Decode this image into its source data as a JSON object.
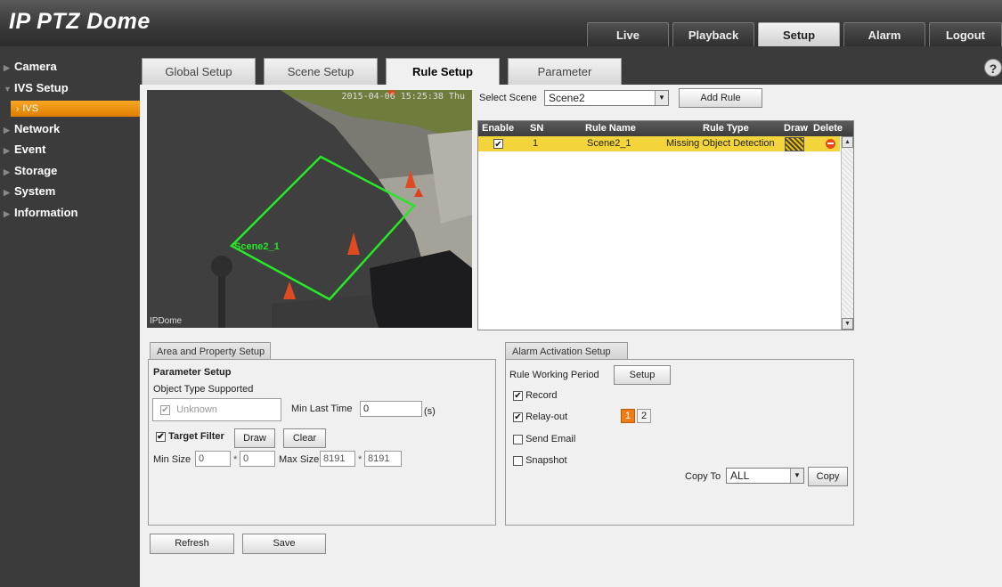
{
  "app": {
    "title": "IP PTZ Dome"
  },
  "topnav": [
    "Live",
    "Playback",
    "Setup",
    "Alarm",
    "Logout"
  ],
  "sidebar": {
    "items": [
      "Camera",
      "IVS Setup",
      "Network",
      "Event",
      "Storage",
      "System",
      "Information"
    ],
    "sub_item": "IVS"
  },
  "tabs": [
    "Global Setup",
    "Scene Setup",
    "Rule Setup",
    "Parameter"
  ],
  "help_icon": "?",
  "video": {
    "timestamp": "2015-04-06 15:25:38 Thu",
    "osd_label": "IPDome",
    "rule_label": "Scene2_1",
    "rule_color": "#27e827"
  },
  "select_scene": {
    "label": "Select Scene",
    "value": "Scene2"
  },
  "add_rule_button": "Add Rule",
  "rule_table": {
    "columns": [
      "Enable",
      "SN",
      "Rule Name",
      "Rule Type",
      "Draw",
      "Delete"
    ],
    "rows": [
      {
        "enabled": "✔",
        "sn": "1",
        "name": "Scene2_1",
        "type": "Missing Object Detection"
      }
    ],
    "row_highlight": "#f3d43a"
  },
  "area_setup": {
    "tab": "Area and Property Setup",
    "parameter_setup": "Parameter Setup",
    "object_type_supported": "Object Type Supported",
    "unknown": "Unknown",
    "min_last_time_label": "Min Last Time",
    "min_last_time_value": "0",
    "unit": "(s)",
    "target_filter": "Target Filter",
    "draw": "Draw",
    "clear": "Clear",
    "min_size_label": "Min Size",
    "min_size_w": "0",
    "min_size_h": "0",
    "max_size_label": "Max Size",
    "max_size_w": "8191",
    "max_size_h": "8191",
    "times": "*"
  },
  "alarm_setup": {
    "tab": "Alarm Activation Setup",
    "rule_working_period": "Rule Working Period",
    "setup": "Setup",
    "record": "Record",
    "relay_out": "Relay-out",
    "relay_1": "1",
    "relay_2": "2",
    "send_email": "Send Email",
    "snapshot": "Snapshot",
    "copy_to_label": "Copy To",
    "copy_to_value": "ALL",
    "copy": "Copy",
    "active_relay_color": "#f07c16"
  },
  "refresh_button": "Refresh",
  "save_button": "Save"
}
